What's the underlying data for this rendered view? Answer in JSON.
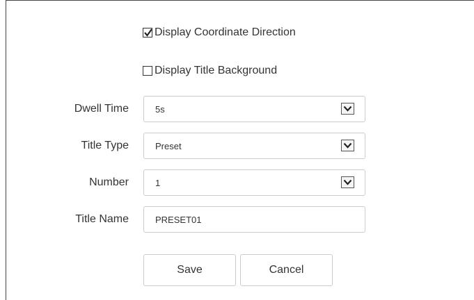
{
  "options": {
    "display_coordinate_direction": {
      "label": "Display Coordinate Direction",
      "checked": true
    },
    "display_title_background": {
      "label": "Display Title Background",
      "checked": false
    }
  },
  "form": {
    "dwell_time": {
      "label": "Dwell Time",
      "value": "5s"
    },
    "title_type": {
      "label": "Title Type",
      "value": "Preset"
    },
    "number": {
      "label": "Number",
      "value": "1"
    },
    "title_name": {
      "label": "Title Name",
      "value": "PRESET01"
    }
  },
  "buttons": {
    "save_label": "Save",
    "cancel_label": "Cancel"
  },
  "icons": {
    "checkbox_checked": "checkmark-icon",
    "dropdown": "chevron-down-icon"
  }
}
